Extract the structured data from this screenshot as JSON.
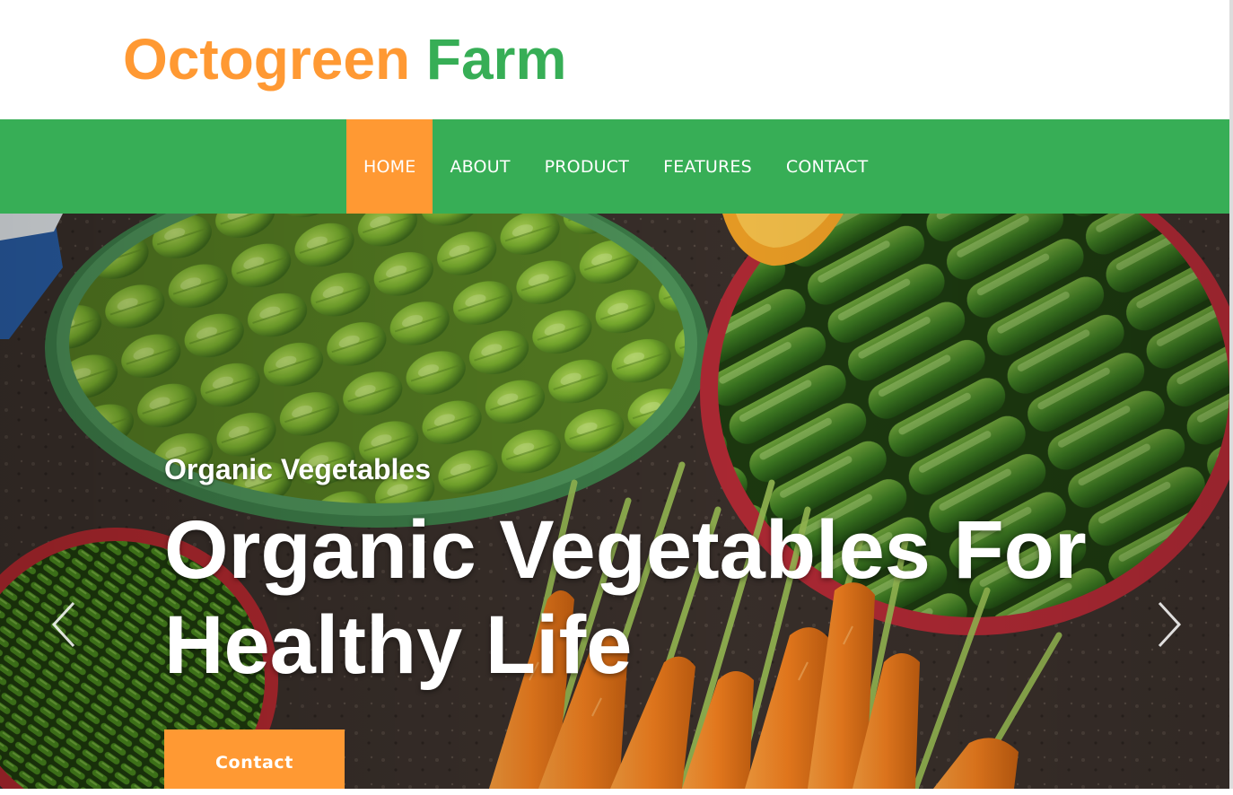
{
  "brand": {
    "name_part1": "Octogreen",
    "name_part2": "Farm",
    "color_part1": "#ff9933",
    "color_part2": "#37ae56"
  },
  "nav": {
    "background": "#37ae56",
    "active_background": "#ff9933",
    "items": [
      {
        "label": "HOME",
        "active": true
      },
      {
        "label": "ABOUT",
        "active": false
      },
      {
        "label": "PRODUCT",
        "active": false
      },
      {
        "label": "FEATURES",
        "active": false
      },
      {
        "label": "CONTACT",
        "active": false
      }
    ]
  },
  "hero": {
    "kicker": "Organic Vegetables",
    "title": "Organic Vegetables For Healthy Life",
    "button_label": "Contact",
    "button_color": "#ff9933",
    "prev_icon": "chevron-left-icon",
    "next_icon": "chevron-right-icon"
  }
}
